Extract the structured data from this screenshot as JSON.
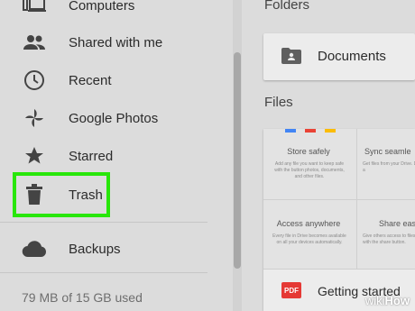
{
  "sidebar": {
    "items": [
      {
        "label": "Computers",
        "icon": "computers-icon"
      },
      {
        "label": "Shared with me",
        "icon": "shared-with-me-icon"
      },
      {
        "label": "Recent",
        "icon": "clock-icon"
      },
      {
        "label": "Google Photos",
        "icon": "pinwheel-icon"
      },
      {
        "label": "Starred",
        "icon": "star-icon"
      },
      {
        "label": "Trash",
        "icon": "trash-icon"
      },
      {
        "label": "Backups",
        "icon": "cloud-icon"
      }
    ],
    "storage_text": "79 MB of 15 GB used",
    "highlight_color": "#28e60a"
  },
  "main": {
    "folders_heading": "Folders",
    "folder": {
      "name": "Documents"
    },
    "files_heading": "Files",
    "tiles": [
      {
        "title": "Store safely",
        "desc": "Add any file you want to keep safe with the button photos, documents, and other files."
      },
      {
        "title": "Sync seamle",
        "desc": "Get files from your Drive. Download it a"
      },
      {
        "title": "Access anywhere",
        "desc": "Every file in Drive becomes available on all your devices automatically."
      },
      {
        "title": "Share eas",
        "desc": "Give others access to files or folders with the share button."
      }
    ],
    "tile_colors": [
      "#4285f4",
      "#ea4335",
      "#fbbc05"
    ],
    "file": {
      "name": "Getting started",
      "type_badge": "PDF"
    }
  },
  "watermark": {
    "part1": "wiki",
    "part2": "How"
  }
}
